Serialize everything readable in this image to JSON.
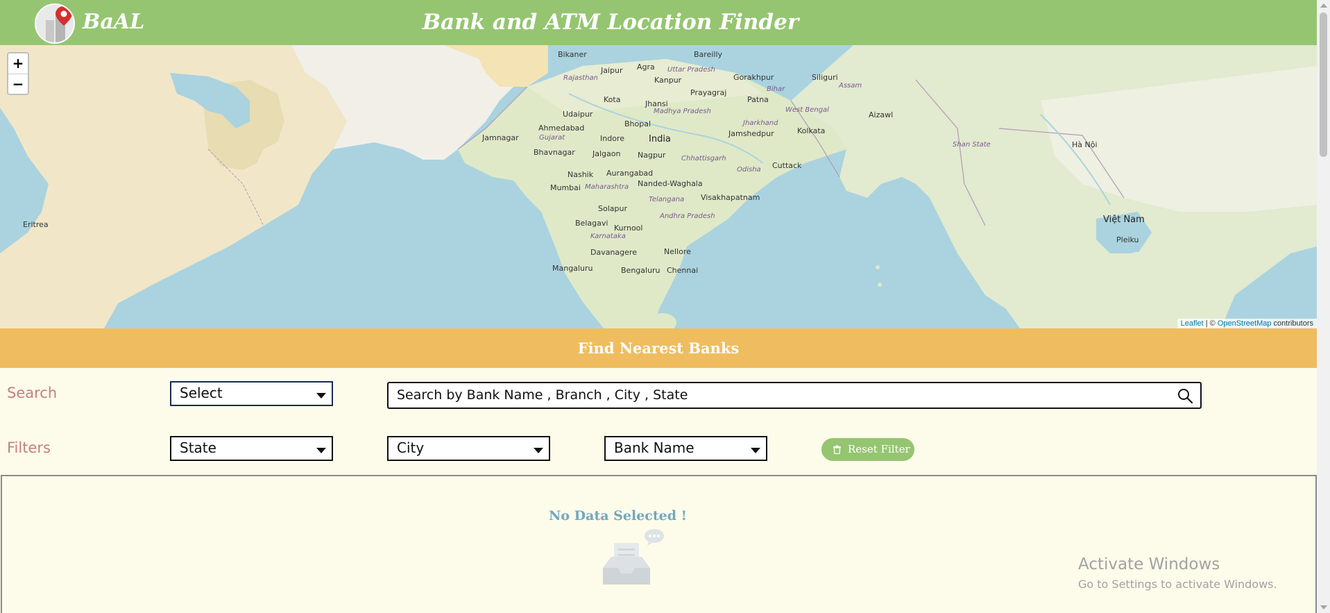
{
  "header": {
    "brand": "BaAL",
    "title": "Bank and ATM Location Finder"
  },
  "map": {
    "zoom_in": "+",
    "zoom_out": "−",
    "attribution": {
      "leaflet": "Leaflet",
      "separator": " | © ",
      "osm": "OpenStreetMap",
      "suffix": " contributors"
    },
    "labels": [
      "Bikaner",
      "Bareilly",
      "Agra",
      "Jaipur",
      "Uttar Pradesh",
      "Kanpur",
      "Gorakhpur",
      "Siliguri",
      "Rajasthan",
      "Prayagraj",
      "Kota",
      "Jhansi",
      "Patna",
      "Bihar",
      "Assam",
      "Udaipur",
      "Madhya Pradesh",
      "Bhopal",
      "Jharkhand",
      "West Bengal",
      "Aizawl",
      "Ahmedabad",
      "India",
      "Jamshedpur",
      "Kolkata",
      "Jamnagar",
      "Gujarat",
      "Indore",
      "Bhavnagar",
      "Jalgaon",
      "Nagpur",
      "Chhattisgarh",
      "Cuttack",
      "Nashik",
      "Aurangabad",
      "Mumbai",
      "Odisha",
      "Nanded-Waghala",
      "Maharashtra",
      "Visakhapatnam",
      "Telangana",
      "Solapur",
      "Belagavi",
      "Andhra Pradesh",
      "Kurnool",
      "Karnataka",
      "Davanagere",
      "Nellore",
      "Mangaluru",
      "Bengaluru",
      "Chennai",
      "Eritrea",
      "Hà Nội",
      "Việt Nam",
      "Pleiku",
      "Shan State"
    ]
  },
  "section": {
    "title": "Find Nearest Banks"
  },
  "search": {
    "label": "Search",
    "type_value": "Select",
    "placeholder": "Search by Bank Name , Branch , City , State"
  },
  "filters": {
    "label": "Filters",
    "state": "State",
    "city": "City",
    "bank": "Bank Name",
    "reset": "Reset Filter"
  },
  "results": {
    "empty_text": "No Data Selected !"
  },
  "watermark": {
    "title": "Activate Windows",
    "subtitle": "Go to Settings to activate Windows."
  },
  "colors": {
    "header": "#95c571",
    "section": "#efbd5f",
    "water": "#aad3df",
    "land": "#f2efe9",
    "background": "#fdfbea"
  },
  "icons": {
    "search": "search-icon",
    "reset": "trash-icon",
    "empty": "inbox-icon",
    "logo": "location-pin-icon"
  }
}
